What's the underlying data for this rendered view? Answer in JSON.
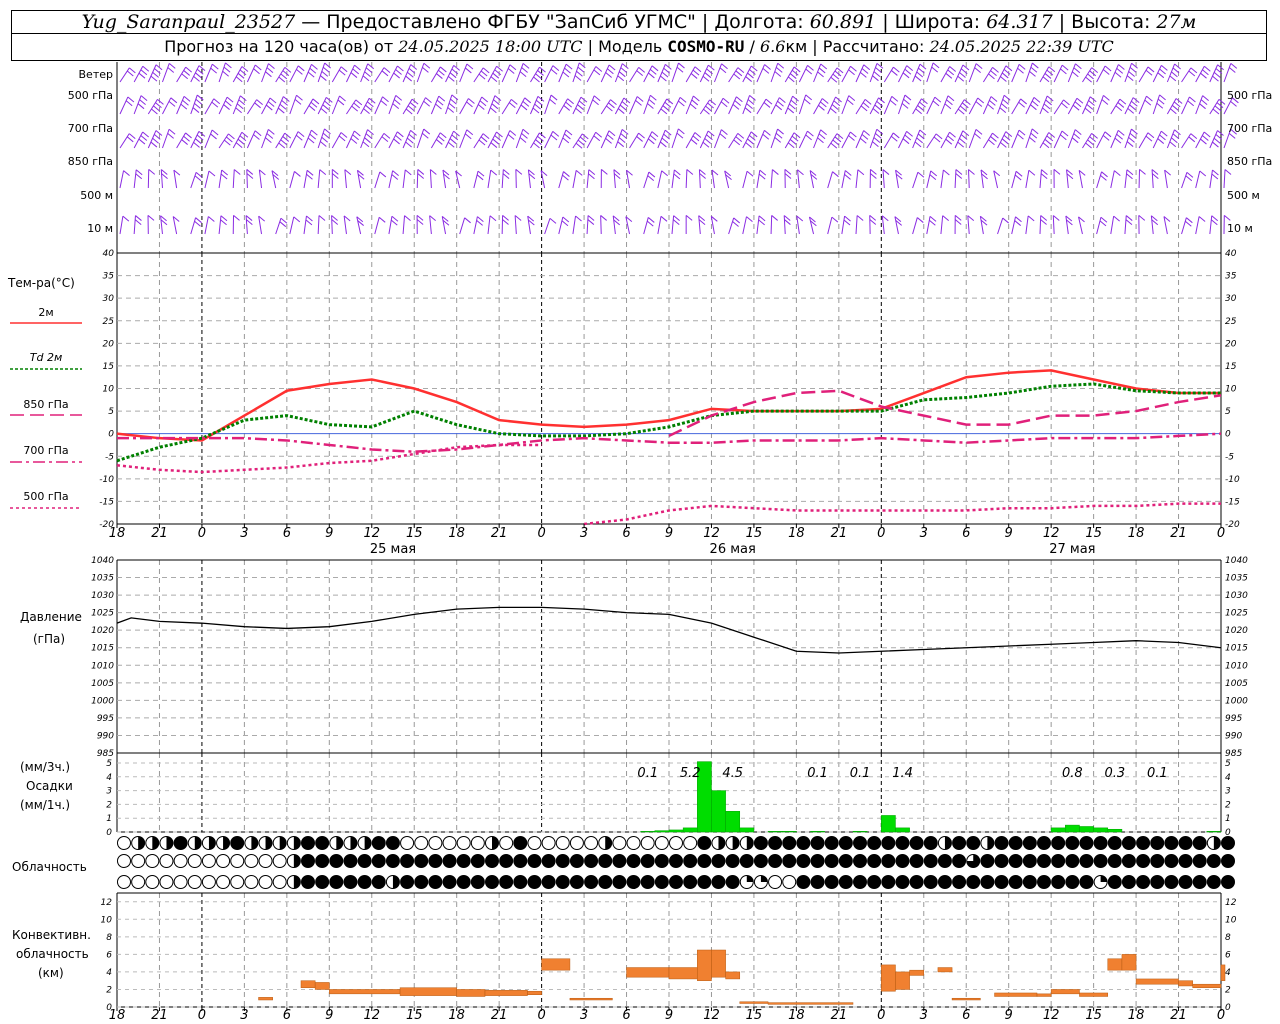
{
  "header": {
    "station": "Yug_Saranpaul_23527",
    "dash": " — ",
    "provider": "Предоставлено ФГБУ \"ЗапСиб УГМС\"",
    "sep": " | ",
    "lon_label": "Долгота: ",
    "lon_value": "60.891",
    "lat_label": "Широта: ",
    "lat_value": "64.317",
    "alt_label": "Высота: ",
    "alt_value": "27м",
    "forecast_label": "Прогноз на 120 часа(ов)  от ",
    "forecast_start": "24.05.2025 18:00 UTC",
    "model_label": "Модель ",
    "model_name": "COSMO-RU",
    "model_res_sep": " / ",
    "model_res": "6.6",
    "model_res_unit": "км",
    "calc_label": "Рассчитано: ",
    "calc_time": "24.05.2025 22:39 UTC"
  },
  "wind_panel": {
    "title": "Ветер",
    "levels": [
      "500 гПа",
      "700 гПа",
      "850 гПа",
      "500 м",
      "10  м"
    ],
    "right_levels": [
      "500 гПа",
      "700 гПа",
      "850 гПа",
      "500 м",
      "10  м"
    ]
  },
  "temp_panel": {
    "title": "Тем-ра(°C)",
    "legend": [
      {
        "label": "2м",
        "color": "#ff3030"
      },
      {
        "label": "Td  2м",
        "color": "#008000"
      },
      {
        "label": "850 гПа",
        "color": "#e0207a"
      },
      {
        "label": "700 гПа",
        "color": "#e0207a"
      },
      {
        "label": "500 гПа",
        "color": "#e0207a"
      }
    ]
  },
  "pressure_panel": {
    "title_line1": "Давление",
    "title_line2": "(гПа)"
  },
  "precip_panel": {
    "line1": "(мм/3ч.)",
    "line2": "Осадки",
    "line3": "(мм/1ч.)"
  },
  "cloud_panel": {
    "title": "Облачность"
  },
  "conv_panel": {
    "line1": "Конвективн.",
    "line2": "облачность",
    "line3": "(км)"
  },
  "colors": {
    "t2m": "#ff3030",
    "td": "#008000",
    "upper": "#e0207a",
    "wind": "#8a2be2",
    "precip": "#00dd00",
    "conv": "#f08030"
  },
  "time_axis": {
    "ticks": [
      "18",
      "21",
      "0",
      "3",
      "6",
      "9",
      "12",
      "15",
      "18",
      "21",
      "0",
      "3",
      "6",
      "9",
      "12",
      "15",
      "18",
      "21",
      "0",
      "3",
      "6",
      "9",
      "12",
      "15",
      "18",
      "21",
      "0"
    ],
    "day_labels": [
      {
        "after_index": 6,
        "text": "25 мая"
      },
      {
        "after_index": 14,
        "text": "26 мая"
      },
      {
        "after_index": 22,
        "text": "27 мая"
      }
    ],
    "hours_start": 0,
    "hours_end": 78,
    "midnights_hours": [
      6,
      30,
      54,
      78
    ]
  },
  "chart_data": [
    {
      "type": "line",
      "title": "Тем-ра(°C)",
      "ylim": [
        -20,
        40
      ],
      "yticks": [
        40,
        35,
        30,
        25,
        20,
        15,
        10,
        5,
        0,
        -5,
        -10,
        -15,
        -20
      ],
      "x_hours": [
        0,
        3,
        6,
        9,
        12,
        15,
        18,
        21,
        24,
        27,
        30,
        33,
        36,
        39,
        42,
        45,
        48,
        51,
        54,
        57,
        60,
        63,
        66,
        69,
        72,
        75,
        78
      ],
      "series": [
        {
          "name": "2м",
          "values": [
            0,
            -1,
            -1.5,
            4,
            9.5,
            11,
            12,
            10,
            7,
            3,
            2,
            1.5,
            2,
            3,
            5.5,
            5,
            5,
            5,
            5.5,
            9,
            12.5,
            13.5,
            14,
            12,
            10,
            9,
            9
          ]
        },
        {
          "name": "Td  2м",
          "values": [
            -6,
            -3,
            -1,
            3,
            4,
            2,
            1.5,
            5,
            2,
            0,
            -0.5,
            -0.5,
            0,
            1.5,
            4,
            5,
            5,
            5,
            5,
            7.5,
            8,
            9,
            10.5,
            11,
            9.5,
            9,
            9
          ]
        },
        {
          "name": "850 гПа",
          "values": [
            null,
            null,
            null,
            null,
            null,
            null,
            null,
            null,
            null,
            null,
            null,
            null,
            null,
            -0.5,
            4,
            7,
            9,
            9.5,
            6,
            4,
            2,
            2,
            4,
            4,
            5,
            7,
            8.5
          ]
        },
        {
          "name": "700 гПа",
          "values": [
            -1,
            -1,
            -1,
            -1,
            -1.5,
            -2.5,
            -3.5,
            -4,
            -3.5,
            -2.5,
            -1.5,
            -1,
            -1.5,
            -2,
            -2,
            -1.5,
            -1.5,
            -1.5,
            -1,
            -1.5,
            -2,
            -1.5,
            -1,
            -1,
            -1,
            -0.5,
            0
          ]
        },
        {
          "name": "500 гПа",
          "values": [
            -7,
            -8,
            -8.5,
            -8,
            -7.5,
            -6.5,
            -6,
            -4.5,
            -3,
            -2.5,
            -2.5,
            -20,
            -19,
            -17,
            -16,
            -16.5,
            -17,
            -17,
            -17,
            -17,
            -17,
            -16.5,
            -16.5,
            -16,
            -16,
            -15.5,
            -15.5
          ]
        }
      ]
    },
    {
      "type": "line",
      "title": "Давление",
      "ylabel": "(гПа)",
      "ylim": [
        985,
        1040
      ],
      "yticks": [
        1040,
        1035,
        1030,
        1025,
        1020,
        1015,
        1010,
        1005,
        1000,
        995,
        990,
        985
      ],
      "x_hours": [
        0,
        1,
        3,
        6,
        9,
        12,
        15,
        18,
        21,
        24,
        27,
        30,
        33,
        36,
        39,
        42,
        45,
        48,
        51,
        54,
        57,
        60,
        63,
        66,
        69,
        72,
        75,
        78
      ],
      "values": [
        1022,
        1023.5,
        1022.5,
        1022,
        1021,
        1020.5,
        1021,
        1022.5,
        1024.5,
        1026,
        1026.5,
        1026.5,
        1026,
        1025,
        1024.5,
        1022,
        1018,
        1014,
        1013.5,
        1014,
        1014.5,
        1015,
        1015.5,
        1016,
        1016.5,
        1017,
        1016.5,
        1015
      ]
    },
    {
      "type": "bar",
      "title": "Осадки",
      "units": [
        "(мм/3ч.)",
        "(мм/1ч.)"
      ],
      "ylim": [
        0,
        5
      ],
      "yticks": [
        5,
        4,
        3,
        2,
        1,
        0
      ],
      "labels_3h": [
        {
          "hour": 37.5,
          "text": "0.1"
        },
        {
          "hour": 40.5,
          "text": "5.2"
        },
        {
          "hour": 43.5,
          "text": "4.5"
        },
        {
          "hour": 49.5,
          "text": "0.1"
        },
        {
          "hour": 52.5,
          "text": "0.1"
        },
        {
          "hour": 55.5,
          "text": "1.4"
        },
        {
          "hour": 67.5,
          "text": "0.8"
        },
        {
          "hour": 70.5,
          "text": "0.3"
        },
        {
          "hour": 73.5,
          "text": "0.1"
        }
      ],
      "hourly": [
        {
          "hour": 37,
          "value": 0.05
        },
        {
          "hour": 38,
          "value": 0.1
        },
        {
          "hour": 39,
          "value": 0.15
        },
        {
          "hour": 40,
          "value": 0.3
        },
        {
          "hour": 41,
          "value": 5.1
        },
        {
          "hour": 42,
          "value": 3
        },
        {
          "hour": 43,
          "value": 1.5
        },
        {
          "hour": 44,
          "value": 0.3
        },
        {
          "hour": 46,
          "value": 0.05
        },
        {
          "hour": 47,
          "value": 0.05
        },
        {
          "hour": 49,
          "value": 0.05
        },
        {
          "hour": 52,
          "value": 0.05
        },
        {
          "hour": 54,
          "value": 1.2
        },
        {
          "hour": 55,
          "value": 0.3
        },
        {
          "hour": 66,
          "value": 0.3
        },
        {
          "hour": 67,
          "value": 0.5
        },
        {
          "hour": 68,
          "value": 0.4
        },
        {
          "hour": 69,
          "value": 0.3
        },
        {
          "hour": 70,
          "value": 0.2
        },
        {
          "hour": 77,
          "value": 0.05
        }
      ]
    },
    {
      "type": "table",
      "title": "Облачность",
      "cover_codes": "0 empty … 8 full (octa symbols)",
      "rows": [
        [
          0,
          4,
          4,
          4,
          8,
          4,
          4,
          4,
          8,
          4,
          4,
          4,
          4,
          8,
          8,
          4,
          4,
          4,
          8,
          8,
          0,
          0,
          0,
          0,
          0,
          0,
          4,
          0,
          8,
          0,
          0,
          0,
          0,
          0,
          4,
          0,
          0,
          0,
          0,
          0,
          0,
          8,
          4,
          4,
          4,
          8,
          8,
          8,
          8,
          8,
          8,
          8,
          8,
          8,
          8,
          8,
          8,
          8,
          4,
          8,
          8,
          4,
          8,
          8,
          8,
          8,
          8,
          8,
          8,
          8,
          8,
          8,
          8,
          8,
          8,
          8,
          8,
          4,
          8,
          4,
          8,
          4,
          4,
          8,
          8,
          8,
          8,
          8,
          8,
          8,
          8,
          8,
          8,
          8,
          8,
          8,
          8,
          8,
          8,
          8,
          8,
          8,
          8,
          8,
          8,
          8,
          8,
          8
        ],
        [
          0,
          0,
          0,
          0,
          0,
          0,
          0,
          0,
          0,
          0,
          0,
          0,
          4,
          8,
          8,
          8,
          8,
          8,
          8,
          8,
          8,
          8,
          8,
          8,
          8,
          8,
          8,
          8,
          8,
          8,
          8,
          8,
          8,
          8,
          8,
          8,
          8,
          8,
          8,
          8,
          8,
          8,
          8,
          8,
          8,
          8,
          8,
          8,
          8,
          8,
          8,
          8,
          8,
          8,
          8,
          8,
          8,
          8,
          8,
          8,
          6,
          8,
          8,
          8,
          8,
          8,
          8,
          8,
          8,
          8,
          8,
          8,
          8,
          8,
          8,
          8,
          8,
          8,
          8,
          8,
          8,
          8,
          8,
          8,
          8,
          8,
          8,
          8,
          8,
          8,
          8,
          8,
          8,
          8,
          8,
          8,
          8,
          8,
          8,
          8,
          8,
          8,
          8,
          8,
          8,
          8,
          8,
          8
        ],
        [
          0,
          0,
          0,
          0,
          0,
          0,
          0,
          0,
          0,
          0,
          0,
          0,
          4,
          8,
          8,
          8,
          8,
          8,
          8,
          4,
          8,
          8,
          8,
          8,
          8,
          8,
          8,
          8,
          8,
          8,
          8,
          8,
          8,
          8,
          8,
          8,
          8,
          8,
          8,
          8,
          8,
          8,
          8,
          8,
          2,
          2,
          0,
          0,
          8,
          8,
          8,
          8,
          8,
          8,
          8,
          8,
          8,
          8,
          8,
          8,
          8,
          8,
          8,
          8,
          8,
          8,
          8,
          8,
          8,
          2,
          8,
          8,
          8,
          8,
          8,
          8,
          8,
          8,
          8,
          8,
          8,
          8,
          8,
          8,
          8,
          4,
          0,
          0,
          0,
          0,
          0,
          0,
          0,
          0,
          8,
          8,
          8,
          8,
          8,
          8,
          8,
          8,
          8,
          8,
          8,
          8,
          8,
          8,
          8,
          8,
          8,
          8
        ]
      ]
    },
    {
      "type": "bar",
      "title": "Конвективн. облачность (км)",
      "ylim": [
        0,
        13
      ],
      "yticks": [
        12,
        10,
        8,
        6,
        4,
        2,
        0
      ],
      "bars": [
        {
          "h0": 10,
          "h1": 11,
          "base": 0.8,
          "top": 1.1
        },
        {
          "h0": 13,
          "h1": 14,
          "base": 2.2,
          "top": 3.0
        },
        {
          "h0": 14,
          "h1": 15,
          "base": 2.0,
          "top": 2.8
        },
        {
          "h0": 15,
          "h1": 20,
          "base": 1.5,
          "top": 2.0
        },
        {
          "h0": 20,
          "h1": 24,
          "base": 1.3,
          "top": 2.2
        },
        {
          "h0": 24,
          "h1": 26,
          "base": 1.2,
          "top": 2.0
        },
        {
          "h0": 26,
          "h1": 29,
          "base": 1.3,
          "top": 1.9
        },
        {
          "h0": 29,
          "h1": 30,
          "base": 1.4,
          "top": 1.8
        },
        {
          "h0": 30,
          "h1": 32,
          "base": 4.2,
          "top": 5.5
        },
        {
          "h0": 32,
          "h1": 35,
          "base": 0.8,
          "top": 1.0
        },
        {
          "h0": 36,
          "h1": 39,
          "base": 3.4,
          "top": 4.5
        },
        {
          "h0": 39,
          "h1": 41,
          "base": 3.2,
          "top": 4.5
        },
        {
          "h0": 41,
          "h1": 42,
          "base": 3.0,
          "top": 6.5
        },
        {
          "h0": 42,
          "h1": 43,
          "base": 3.4,
          "top": 6.5
        },
        {
          "h0": 43,
          "h1": 44,
          "base": 3.2,
          "top": 4.0
        },
        {
          "h0": 44,
          "h1": 46,
          "base": 0.4,
          "top": 0.6
        },
        {
          "h0": 46,
          "h1": 52,
          "base": 0.3,
          "top": 0.5
        },
        {
          "h0": 54,
          "h1": 55,
          "base": 1.8,
          "top": 4.8
        },
        {
          "h0": 55,
          "h1": 56,
          "base": 2.0,
          "top": 4.0
        },
        {
          "h0": 56,
          "h1": 57,
          "base": 3.6,
          "top": 4.2
        },
        {
          "h0": 58,
          "h1": 59,
          "base": 4.0,
          "top": 4.5
        },
        {
          "h0": 59,
          "h1": 61,
          "base": 0.8,
          "top": 1.0
        },
        {
          "h0": 62,
          "h1": 65,
          "base": 1.2,
          "top": 1.6
        },
        {
          "h0": 65,
          "h1": 66,
          "base": 1.2,
          "top": 1.5
        },
        {
          "h0": 66,
          "h1": 68,
          "base": 1.5,
          "top": 2.0
        },
        {
          "h0": 68,
          "h1": 70,
          "base": 1.2,
          "top": 1.6
        },
        {
          "h0": 70,
          "h1": 71,
          "base": 4.2,
          "top": 5.5
        },
        {
          "h0": 71,
          "h1": 72,
          "base": 4.2,
          "top": 6.0
        },
        {
          "h0": 72,
          "h1": 75,
          "base": 2.6,
          "top": 3.2
        },
        {
          "h0": 75,
          "h1": 76,
          "base": 2.4,
          "top": 3.0
        },
        {
          "h0": 76,
          "h1": 78,
          "base": 2.2,
          "top": 2.6
        },
        {
          "h0": 78,
          "h1": 79,
          "base": 3.0,
          "top": 4.8
        }
      ]
    }
  ]
}
